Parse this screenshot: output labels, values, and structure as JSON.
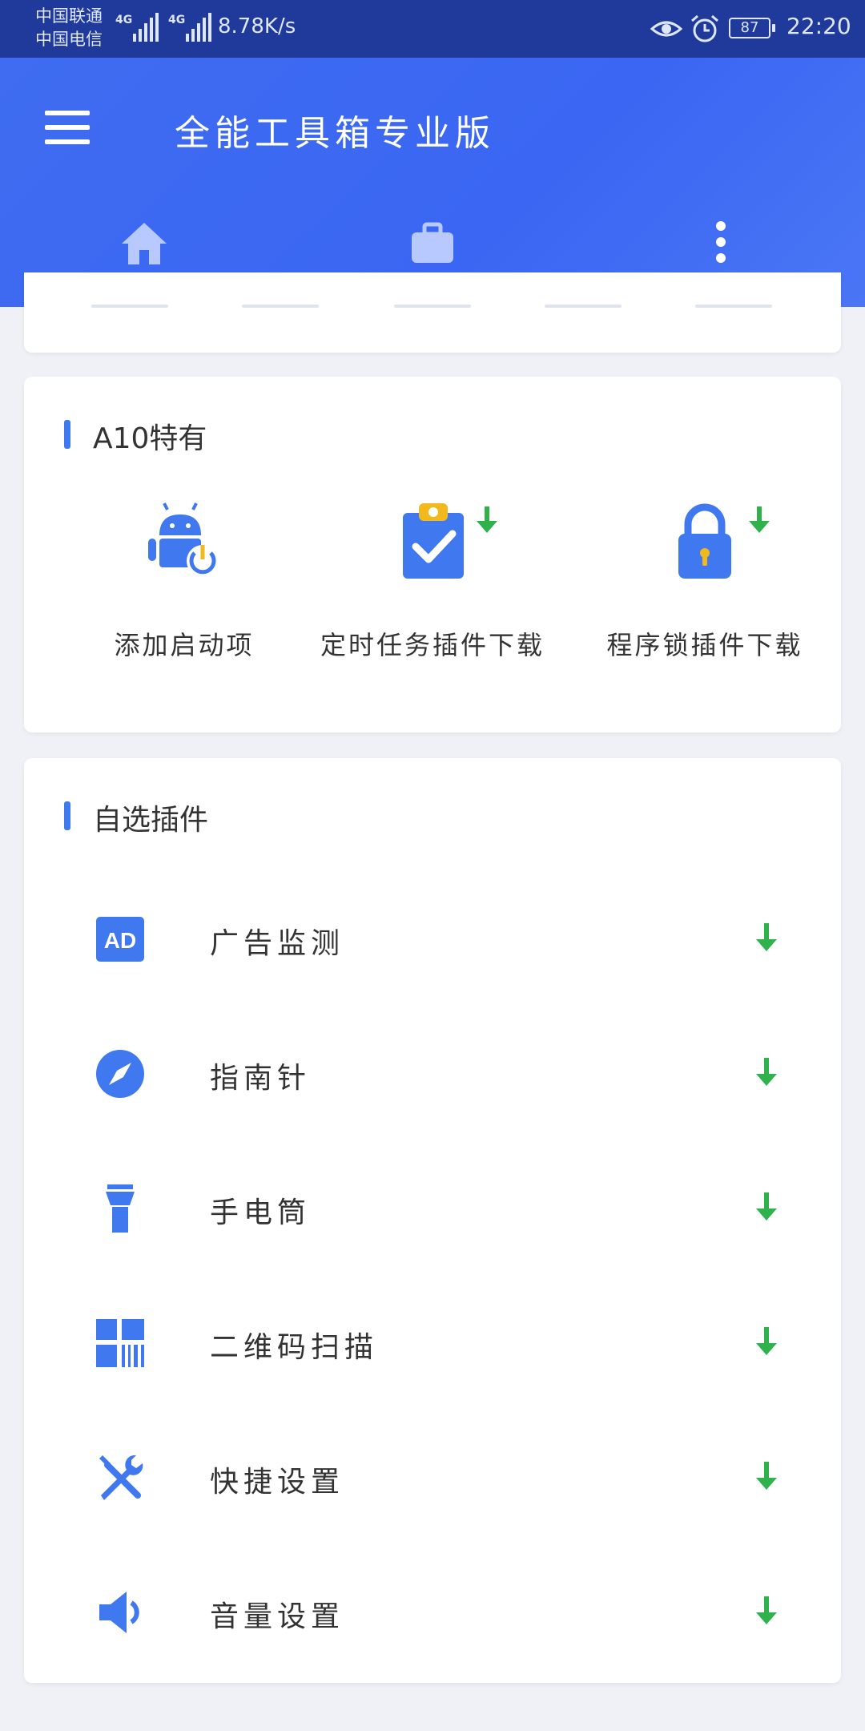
{
  "status_bar": {
    "carrier_1": "中国联通",
    "carrier_2": "中国电信",
    "net_type_1": "4G",
    "net_type_2": "4G",
    "net_speed": "8.78K/s",
    "battery": "87",
    "time": "22:20"
  },
  "header": {
    "title": "全能工具箱专业版",
    "tabs": [
      {
        "icon": "home-icon"
      },
      {
        "icon": "briefcase-icon"
      },
      {
        "icon": "more-vert-icon"
      }
    ],
    "active_tab": 2
  },
  "section_a10": {
    "title": "A10特有",
    "items": [
      {
        "label": "添加启动项",
        "icon": "android-power-icon",
        "download": false
      },
      {
        "label": "定时任务插件下载",
        "icon": "clipboard-check-icon",
        "download": true
      },
      {
        "label": "程序锁插件下载",
        "icon": "lock-icon",
        "download": true
      }
    ]
  },
  "section_plugins": {
    "title": "自选插件",
    "items": [
      {
        "label": "广告监测",
        "icon": "ad-icon",
        "icon_text": "AD"
      },
      {
        "label": "指南针",
        "icon": "compass-icon"
      },
      {
        "label": "手电筒",
        "icon": "flashlight-icon"
      },
      {
        "label": "二维码扫描",
        "icon": "qr-scan-icon"
      },
      {
        "label": "快捷设置",
        "icon": "tools-icon"
      },
      {
        "label": "音量设置",
        "icon": "volume-icon"
      }
    ]
  },
  "colors": {
    "status_bar": "#1f3a9b",
    "header": "#3f6cf0",
    "accent": "#3f78ef",
    "download": "#2fb24c",
    "background": "#eff1f6"
  }
}
